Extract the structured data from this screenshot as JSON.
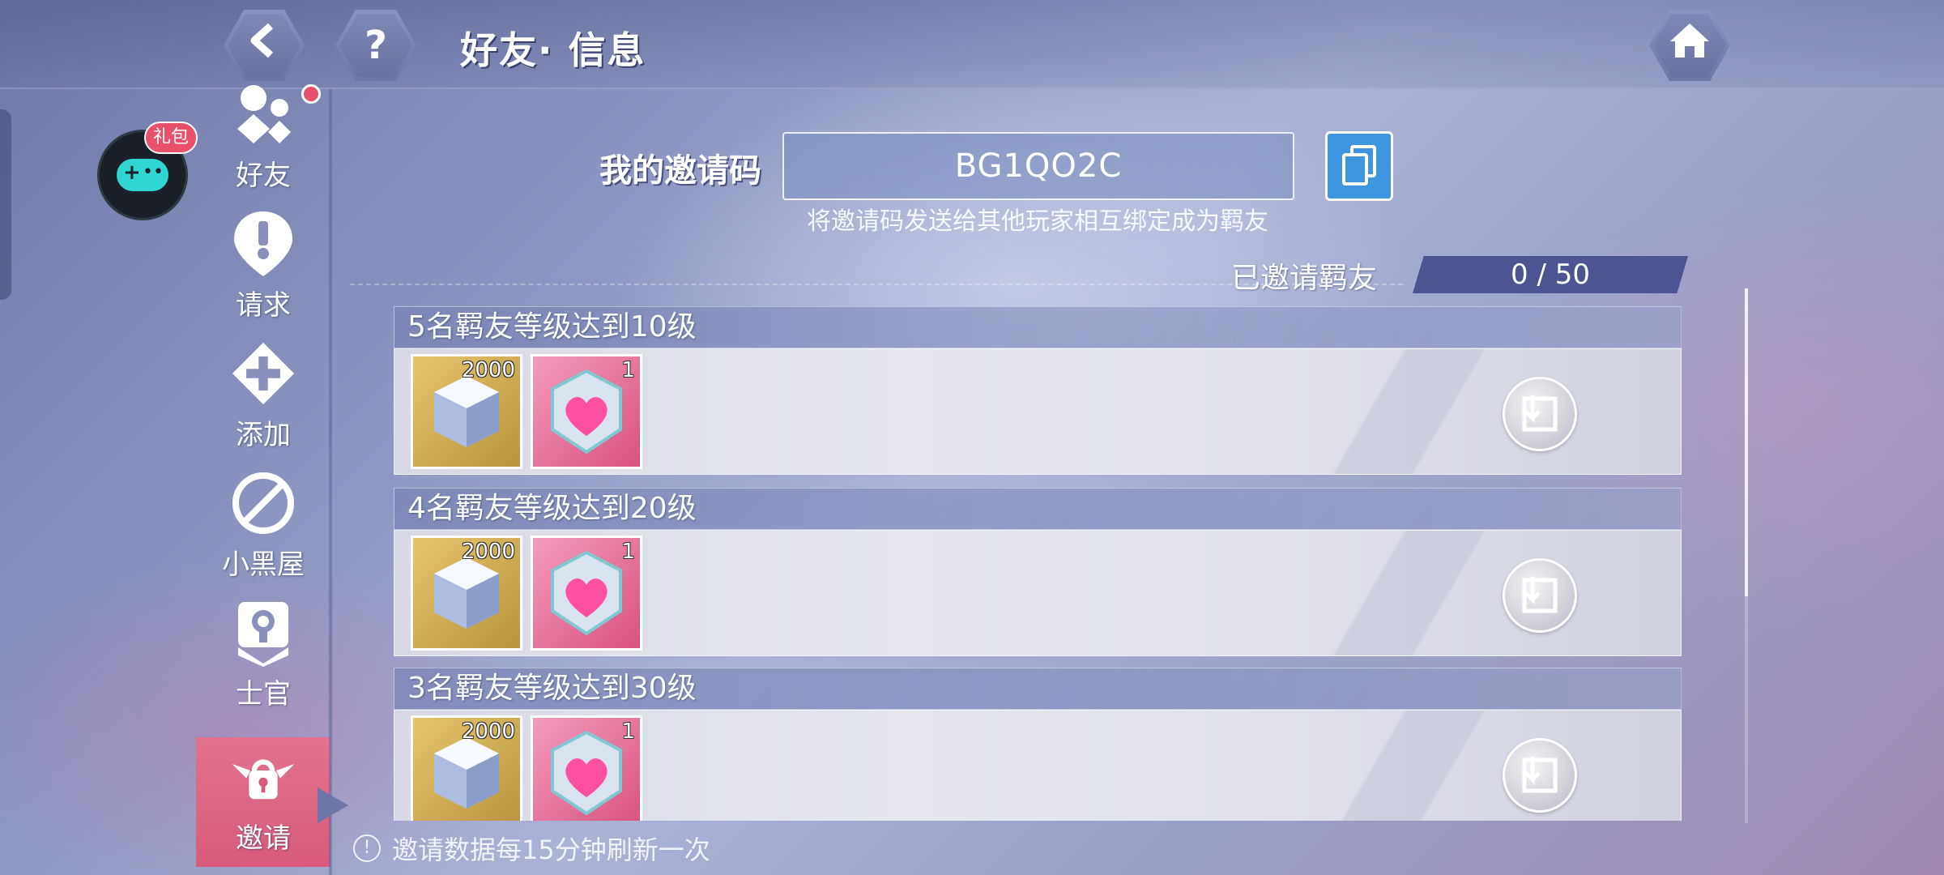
{
  "header": {
    "title": "好友· 信息",
    "back_icon": "back-arrow-icon",
    "help_label": "?",
    "home_icon": "home-icon"
  },
  "profile": {
    "gift_badge": "礼包"
  },
  "sidebar": {
    "items": [
      {
        "label": "好友",
        "icon": "friends-icon"
      },
      {
        "label": "请求",
        "icon": "exclamation-icon"
      },
      {
        "label": "添加",
        "icon": "plus-icon"
      },
      {
        "label": "小黑屋",
        "icon": "block-icon"
      },
      {
        "label": "士官",
        "icon": "officer-icon"
      },
      {
        "label": "邀请",
        "icon": "invite-icon",
        "active": true
      }
    ]
  },
  "invite": {
    "label": "我的邀请码",
    "code": "BG1QO2C",
    "hint": "将邀请码发送给其他玩家相互绑定成为羁友",
    "invited_label": "已邀请羁友",
    "invited_count": "0 / 50"
  },
  "tasks": [
    {
      "title": "5名羁友等级达到10级",
      "rewards": [
        {
          "type": "crystal",
          "qty": "2000"
        },
        {
          "type": "heart-badge",
          "qty": "1"
        }
      ]
    },
    {
      "title": "4名羁友等级达到20级",
      "rewards": [
        {
          "type": "crystal",
          "qty": "2000"
        },
        {
          "type": "heart-badge",
          "qty": "1"
        }
      ]
    },
    {
      "title": "3名羁友等级达到30级",
      "rewards": [
        {
          "type": "crystal",
          "qty": "2000"
        },
        {
          "type": "heart-badge",
          "qty": "1"
        }
      ]
    }
  ],
  "footer": {
    "note": "邀请数据每15分钟刷新一次",
    "icon": "info-icon"
  },
  "colors": {
    "accent_pink": "#d75a7b",
    "copy_blue": "#3e95e0",
    "badge_red": "#e9506b"
  }
}
